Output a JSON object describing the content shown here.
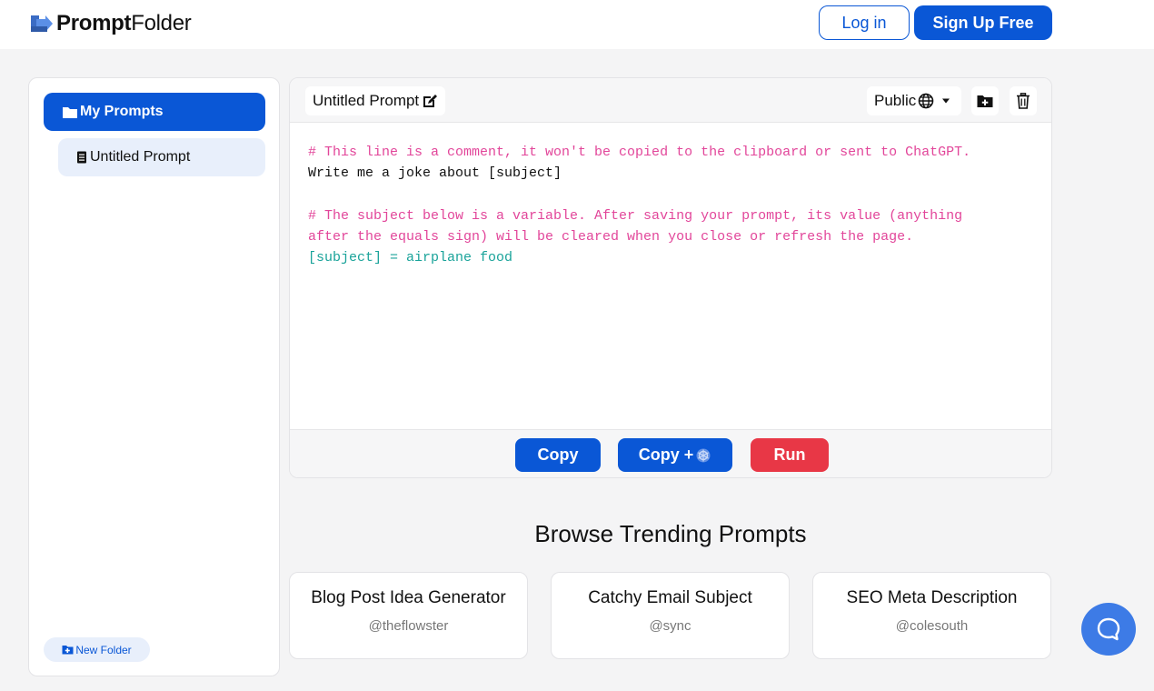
{
  "header": {
    "logo_bold": "Prompt",
    "logo_regular": "Folder",
    "login_label": "Log in",
    "signup_label": "Sign Up Free"
  },
  "sidebar": {
    "folder_label": "My Prompts",
    "prompt_label": "Untitled Prompt",
    "new_folder_label": "New Folder"
  },
  "editor": {
    "title": "Untitled Prompt",
    "visibility": "Public",
    "lines": [
      {
        "type": "comment",
        "text": "# This line is a comment, it won't be copied to the clipboard or sent to ChatGPT."
      },
      {
        "type": "text",
        "text": "Write me a joke about [subject]"
      },
      {
        "type": "blank",
        "text": ""
      },
      {
        "type": "comment",
        "text": "# The subject below is a variable. After saving your prompt, its value (anything"
      },
      {
        "type": "comment",
        "text": "after the equals sign) will be cleared when you close or refresh the page."
      },
      {
        "type": "var",
        "text": "[subject] = airplane food"
      }
    ],
    "copy_label": "Copy",
    "copy_plus_label": "Copy +",
    "run_label": "Run"
  },
  "trending": {
    "title": "Browse Trending Prompts",
    "cards": [
      {
        "title": "Blog Post Idea Generator",
        "author": "@theflowster"
      },
      {
        "title": "Catchy Email Subject",
        "author": "@sync"
      },
      {
        "title": "SEO Meta Description",
        "author": "@colesouth"
      }
    ]
  },
  "colors": {
    "brand": "#0a57d6",
    "run": "#e83746",
    "comment": "#e2469a",
    "variable": "#1aa39a",
    "chat": "#3d7be6"
  }
}
